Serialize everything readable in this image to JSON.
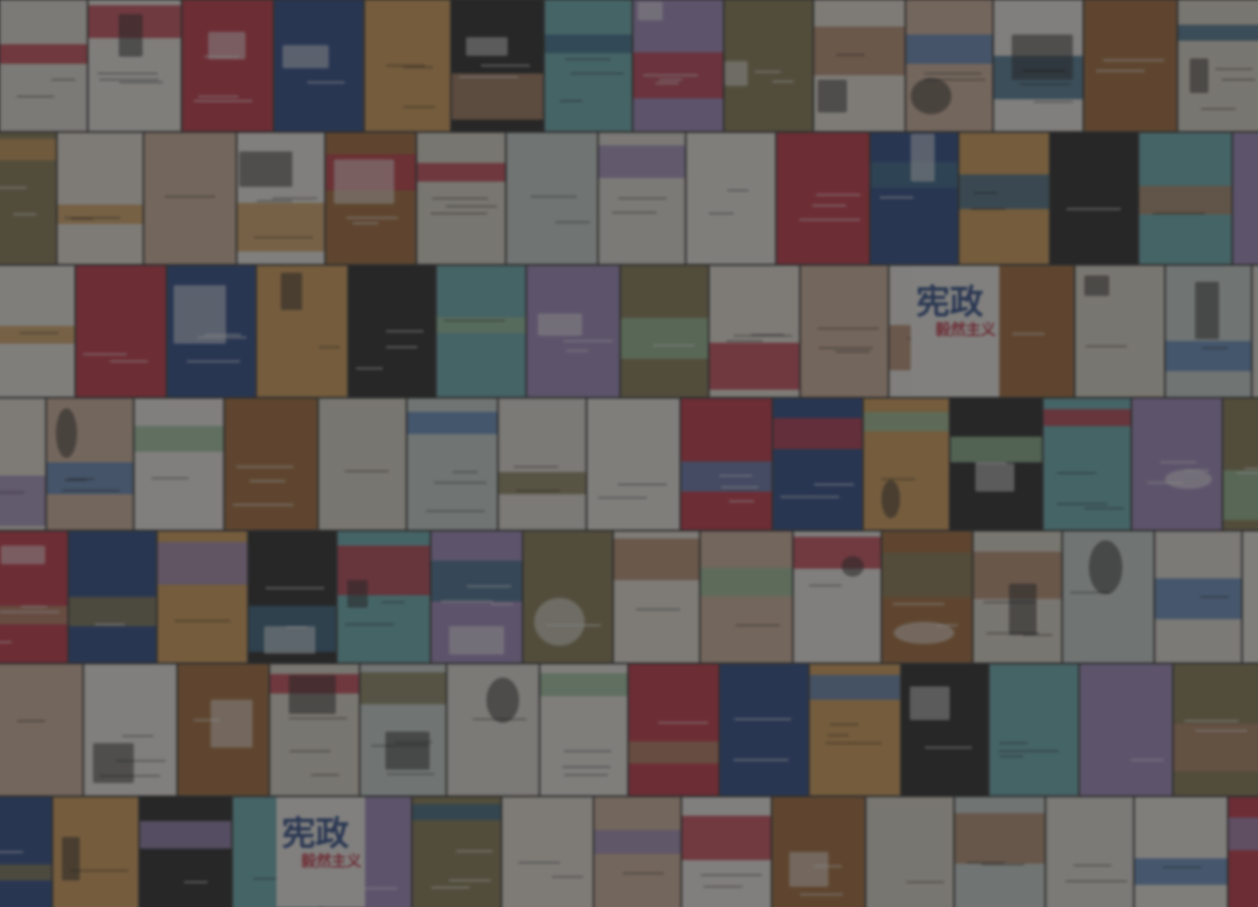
{
  "wall": {
    "titles": [
      {
        "id": "xianzheng-top",
        "text": "宪政"
      },
      {
        "id": "xianzheng-sub",
        "text": "毅然主义"
      },
      {
        "id": "xianzheng-bottom",
        "text": "宪政"
      },
      {
        "id": "xianzheng-bottom-sub",
        "text": "毅然主义"
      }
    ],
    "colors": {
      "overlay": "#262626",
      "accent_red": "#c8384a",
      "accent_blue": "#2f4d8c",
      "accent_ochre": "#d9a25c",
      "accent_dark": "#2a2a2a",
      "accent_teal": "#6fb3b8",
      "accent_lilac": "#a58fc4",
      "accent_olive": "#8c8058",
      "accent_green": "#9ec7a0",
      "paper": "#ebe7df"
    }
  }
}
